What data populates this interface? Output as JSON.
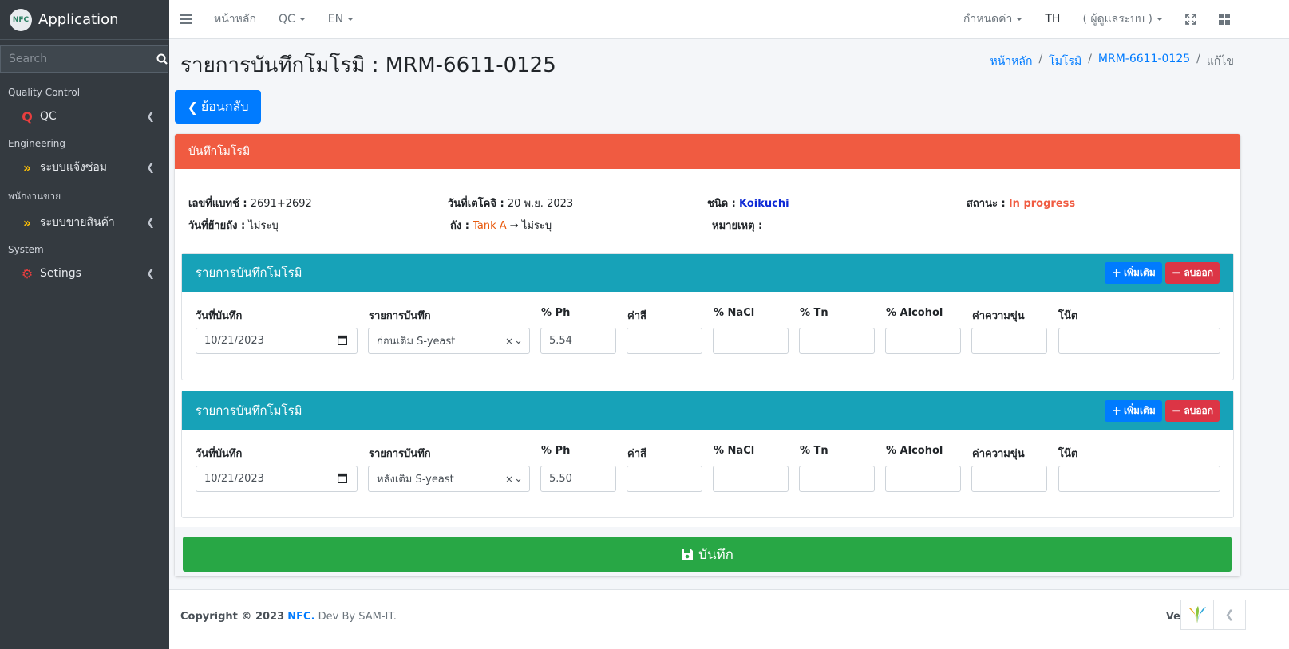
{
  "sidebar": {
    "brand": "Application",
    "logo_text": "NFC",
    "search_placeholder": "Search",
    "sections": [
      {
        "header": "Quality Control",
        "item": "QC",
        "icon": "qc-icon"
      },
      {
        "header": "Engineering",
        "item": "ระบบแจ้งซ่อม",
        "icon": "double-chevron-icon"
      },
      {
        "header": "พนักงานขาย",
        "item": "ระบบขายสินค้า",
        "icon": "double-chevron-icon"
      },
      {
        "header": "System",
        "item": "Setings",
        "icon": "gears-icon"
      }
    ]
  },
  "topnav": {
    "home": "หน้าหลัก",
    "qc": "QC",
    "lang": "EN",
    "settings": "กำหนดค่า",
    "lang_current": "TH",
    "user": "( ผู้ดูแลระบบ )"
  },
  "page": {
    "title": "รายการบันทึกโมโรมิ : MRM-6611-0125",
    "breadcrumb": [
      "หน้าหลัก",
      "โมโรมิ",
      "MRM-6611-0125",
      "แก้ไข"
    ],
    "back_label": "ย้อนกลับ"
  },
  "card": {
    "title": "บันทึกโมโรมิ",
    "batch_label": "เลขที่แบทช์ :",
    "batch_value": "2691+2692",
    "date_label": "วันที่เตโคจิ :",
    "date_value": "20 พ.ย. 2023",
    "type_label": "ชนิด :",
    "type_value": "Koikuchi",
    "status_label": "สถานะ :",
    "status_value": "In progress",
    "move_label": "วันที่ย้ายถัง :",
    "move_value": "ไม่ระบุ",
    "tank_label": "ถัง :",
    "tank_from": "Tank A",
    "tank_arrow": "→",
    "tank_to": "ไม่ระบุ",
    "note_label": "หมายเหตุ :"
  },
  "records": [
    {
      "title": "รายการบันทึกโมโรมิ",
      "add": "เพิ่มเติม",
      "remove": "ลบออก",
      "labels": [
        "วันที่บันทึก",
        "รายการบันทึก",
        "% Ph",
        "ค่าสี",
        "% NaCl",
        "% Tn",
        "% Alcohol",
        "ค่าความขุ่น",
        "โน๊ต"
      ],
      "date": "10/21/2023",
      "item": "ก่อนเติม S-yeast",
      "ph": "5.54"
    },
    {
      "title": "รายการบันทึกโมโรมิ",
      "add": "เพิ่มเติม",
      "remove": "ลบออก",
      "labels": [
        "วันที่บันทึก",
        "รายการบันทึก",
        "% Ph",
        "ค่าสี",
        "% NaCl",
        "% Tn",
        "% Alcohol",
        "ค่าความขุ่น",
        "โน๊ต"
      ],
      "date": "10/21/2023",
      "item": "หลังเติม S-yeast",
      "ph": "5.50"
    }
  ],
  "save_label": "บันทึก",
  "footer": {
    "copyright": "Copyright © 2023",
    "brand": "NFC.",
    "dev": "Dev By SAM-IT.",
    "version": "Ve"
  },
  "colors": {
    "card_header": "#f05b41",
    "sub_header": "#17a2b8",
    "save": "#28a745",
    "primary": "#007bff",
    "danger": "#dc3545"
  }
}
